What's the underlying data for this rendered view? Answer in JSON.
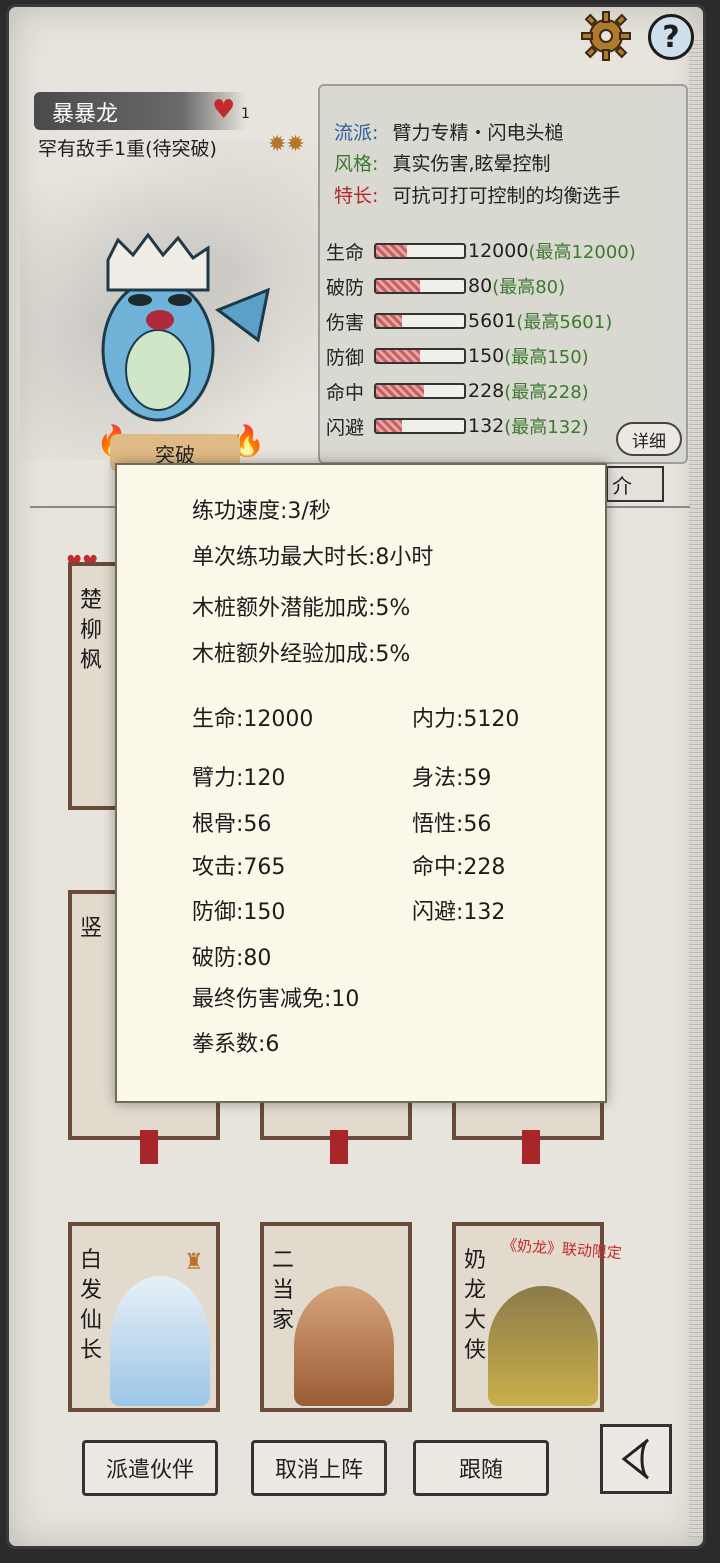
{
  "header": {
    "gear_icon": "settings-gear",
    "help_label": "?"
  },
  "character": {
    "name": "暴暴龙",
    "likes": "1",
    "subtitle": "罕有敌手1重(待突破)",
    "breakthrough_label": "突破"
  },
  "info": {
    "school_label": "流派:",
    "school_value": "臂力专精・闪电头槌",
    "style_label": "风格:",
    "style_value": "真实伤害,眩晕控制",
    "specialty_label": "特长:",
    "specialty_value": "可抗可打可控制的均衡选手",
    "label_colors": {
      "school": "#2f5f9c",
      "style": "#3d7a2f",
      "specialty": "#b02a2a"
    }
  },
  "stats": [
    {
      "label": "生命",
      "value": "12000",
      "max": "(最高12000)",
      "fill": 0.35
    },
    {
      "label": "破防",
      "value": "80",
      "max": "(最高80)",
      "fill": 0.5
    },
    {
      "label": "伤害",
      "value": "5601",
      "max": "(最高5601)",
      "fill": 0.3
    },
    {
      "label": "防御",
      "value": "150",
      "max": "(最高150)",
      "fill": 0.5
    },
    {
      "label": "命中",
      "value": "228",
      "max": "(最高228)",
      "fill": 0.55
    },
    {
      "label": "闪避",
      "value": "132",
      "max": "(最高132)",
      "fill": 0.3
    }
  ],
  "detail_label": "详细",
  "intro_fragment": "介",
  "cards": [
    {
      "name_lines": [
        "楚",
        "柳",
        "枫"
      ]
    },
    {
      "name_lines": [
        "竖"
      ]
    },
    {
      "name_lines": [
        "白",
        "发",
        "仙",
        "长"
      ]
    },
    {
      "name_lines": [
        "二",
        "当",
        "家"
      ]
    },
    {
      "name_lines": [
        "奶",
        "龙",
        "大",
        "侠"
      ]
    }
  ],
  "collab_tag": "《奶龙》联动限定",
  "bottom": {
    "dispatch": "派遣伙伴",
    "cancel": "取消上阵",
    "follow": "跟随"
  },
  "modal": {
    "speed": "练功速度:3/秒",
    "max_duration": "单次练功最大时长:8小时",
    "potential_bonus": "木桩额外潜能加成:5%",
    "exp_bonus": "木桩额外经验加成:5%",
    "hp": "生命:12000",
    "mp": "内力:5120",
    "arm": "臂力:120",
    "agility": "身法:59",
    "bone": "根骨:56",
    "insight": "悟性:56",
    "attack": "攻击:765",
    "hit": "命中:228",
    "defense": "防御:150",
    "dodge": "闪避:132",
    "penetration": "破防:80",
    "final_reduction": "最终伤害减免:10",
    "fist_coef": "拳系数:6"
  }
}
